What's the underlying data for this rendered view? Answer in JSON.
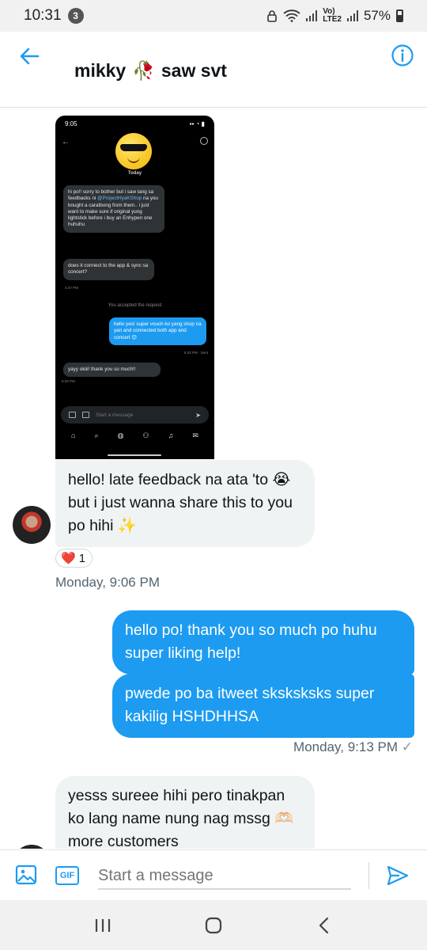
{
  "status_bar": {
    "time": "10:31",
    "notification_count": "3",
    "network_label": "Vo)",
    "network_sub": "LTE2",
    "battery": "57%"
  },
  "header": {
    "contact_name": "mikky",
    "contact_emoji": "🥀",
    "contact_suffix": "saw svt"
  },
  "screenshot": {
    "time": "9:05",
    "day": "Today",
    "msg1": "hi po!! sorry to bother but i saw lang sa feedbacks ni",
    "msg1_link": "@ProjectHyaKShop",
    "msg1_rest": "na you bought a caratbong from them.. i just want to make sure if original yung lightstick before i buy an Enhypen one huhuhu",
    "msg2": "does it connect to the app & sync sa concert?",
    "msg2_time": "4:37 PM",
    "system": "You accepted the request",
    "reply": "hello yes! super vouch ko yang shop na yan and connected both app and concert 😊",
    "reply_time": "5:32 PM · Sent",
    "msg3": "yayy okiii! thank you so much!!",
    "msg3_time": "5:34 PM",
    "compose_placeholder": "Start a message"
  },
  "messages": {
    "incoming1": "hello! late feedback na ata 'to 😭 but i just wanna share this to you po hihi ✨",
    "reaction_emoji": "❤️",
    "reaction_count": "1",
    "time1": "Monday, 9:06 PM",
    "outgoing1": "hello po! thank you so much po huhu super liking help!",
    "outgoing2": "pwede po ba itweet sksksksks super kakilig HSHDHHSA",
    "time2": "Monday, 9:13 PM",
    "incoming2": "yesss sureee hihi pero tinakpan ko lang name nung nag mssg 🫶🏻 more customers"
  },
  "compose": {
    "gif_label": "GIF",
    "placeholder": "Start a message"
  },
  "colors": {
    "accent": "#1d9bf0",
    "incoming_bubble": "#eff3f4",
    "meta_text": "#536471"
  }
}
